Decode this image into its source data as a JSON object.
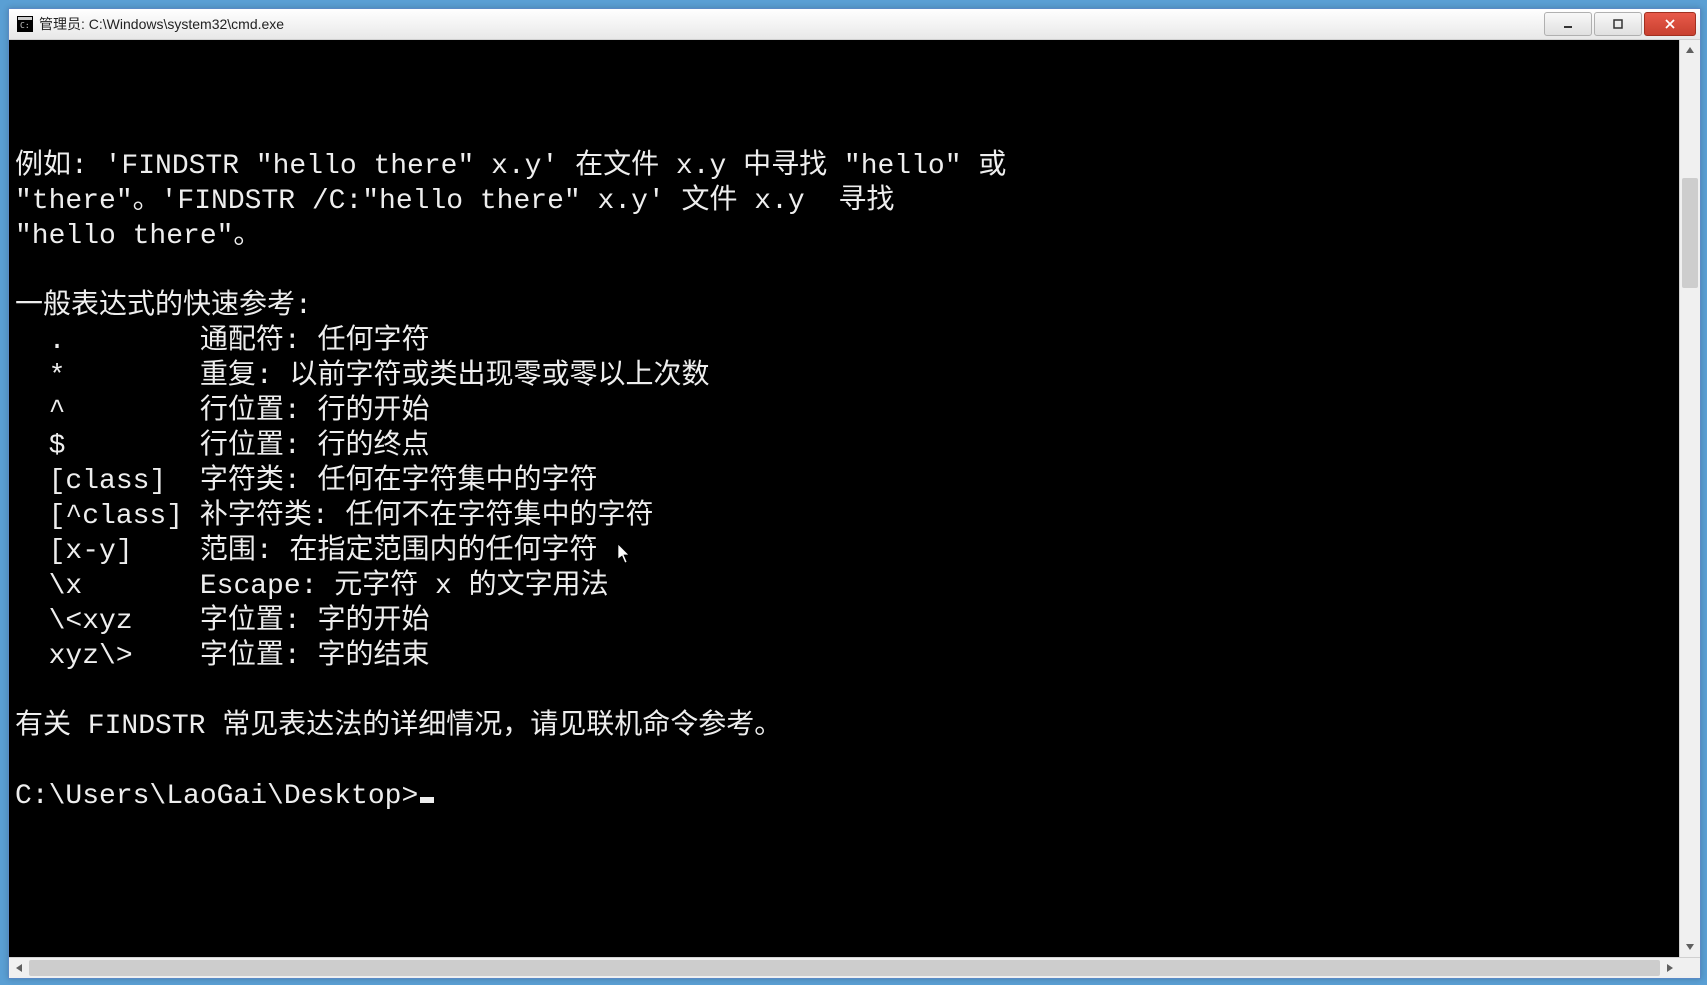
{
  "window": {
    "title": "管理员: C:\\Windows\\system32\\cmd.exe"
  },
  "console": {
    "lines": [
      "例如: 'FINDSTR \"hello there\" x.y' 在文件 x.y 中寻找 \"hello\" 或",
      "\"there\"。'FINDSTR /C:\"hello there\" x.y' 文件 x.y  寻找",
      "\"hello there\"。",
      "",
      "一般表达式的快速参考:",
      "  .        通配符: 任何字符",
      "  *        重复: 以前字符或类出现零或零以上次数",
      "  ^        行位置: 行的开始",
      "  $        行位置: 行的终点",
      "  [class]  字符类: 任何在字符集中的字符",
      "  [^class] 补字符类: 任何不在字符集中的字符",
      "  [x-y]    范围: 在指定范围内的任何字符",
      "  \\x       Escape: 元字符 x 的文字用法",
      "  \\<xyz    字位置: 字的开始",
      "  xyz\\>    字位置: 字的结束",
      "",
      "有关 FINDSTR 常见表达法的详细情况，请见联机命令参考。",
      ""
    ],
    "prompt": "C:\\Users\\LaoGai\\Desktop>"
  }
}
